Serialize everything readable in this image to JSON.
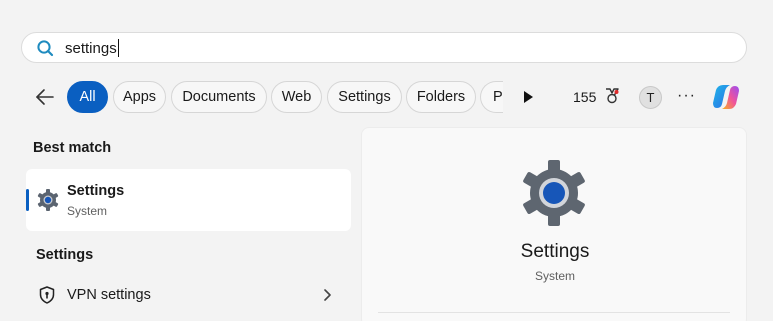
{
  "search": {
    "value": "settings",
    "icon": "search-icon",
    "accent": "#1f8bbf"
  },
  "filters": {
    "items": [
      {
        "label": "All",
        "active": true
      },
      {
        "label": "Apps"
      },
      {
        "label": "Documents"
      },
      {
        "label": "Web"
      },
      {
        "label": "Settings"
      },
      {
        "label": "Folders"
      },
      {
        "label": "Pl"
      }
    ],
    "points": "155",
    "avatar_initial": "T",
    "more_label": "···"
  },
  "left": {
    "best_match_title": "Best match",
    "best_match": {
      "title": "Settings",
      "subtitle": "System"
    },
    "settings_section_title": "Settings",
    "settings_items": [
      {
        "label": "VPN settings"
      }
    ]
  },
  "detail": {
    "title": "Settings",
    "subtitle": "System"
  },
  "colors": {
    "accent": "#0a5fc1",
    "background": "#f3f3f3"
  }
}
